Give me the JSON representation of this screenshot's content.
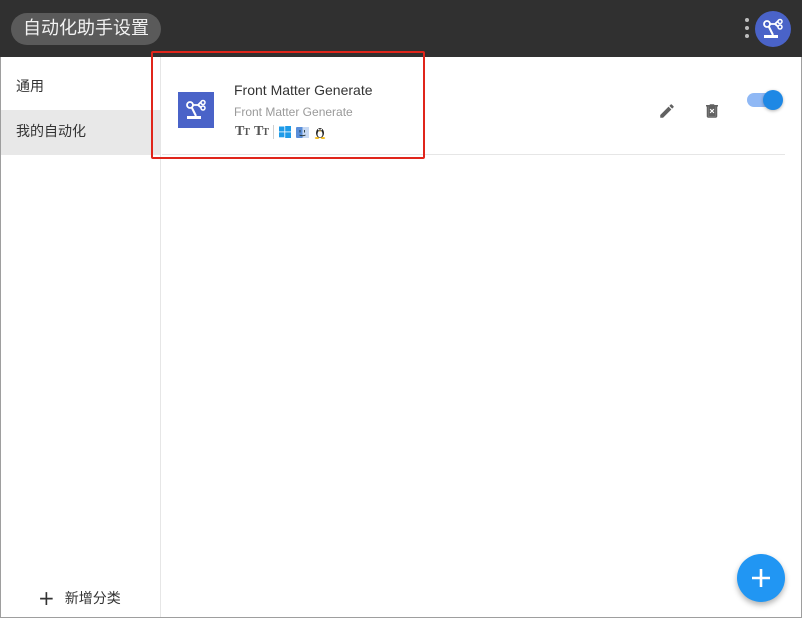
{
  "header": {
    "title": "自动化助手设置",
    "menu_icon": "more-vert-icon",
    "avatar_icon": "robot-arm-icon"
  },
  "sidebar": {
    "items": [
      {
        "label": "通用",
        "active": false
      },
      {
        "label": "我的自动化",
        "active": true
      }
    ],
    "add_category_label": "新增分类"
  },
  "automations": [
    {
      "title": "Front Matter Generate",
      "subtitle": "Front Matter Generate",
      "icon": "robot-arm-icon",
      "badges": [
        "text-format-icon",
        "text-format-icon",
        "windows-icon",
        "macos-icon",
        "linux-icon"
      ],
      "enabled": true,
      "actions": [
        "edit-icon",
        "delete-icon"
      ]
    }
  ],
  "colors": {
    "header_bg": "#303030",
    "accent": "#2196f3",
    "icon_bg": "#4a63c8",
    "highlight": "#e0251b"
  },
  "fab_icon": "plus-icon"
}
